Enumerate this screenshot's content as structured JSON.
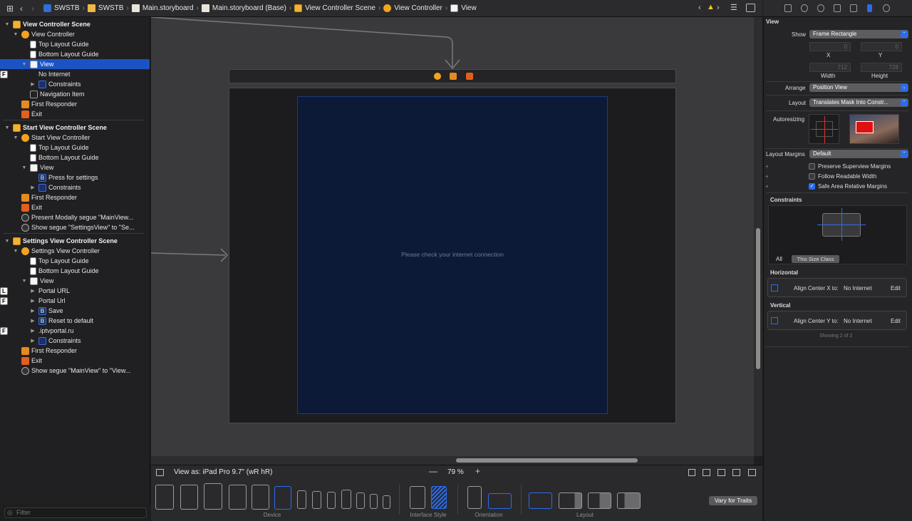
{
  "breadcrumb": [
    "SWSTB",
    "SWSTB",
    "Main.storyboard",
    "Main.storyboard (Base)",
    "View Controller Scene",
    "View Controller",
    "View"
  ],
  "outline": [
    {
      "label": "View Controller Scene",
      "kind": "scene",
      "indent": 0,
      "tri": "▼",
      "header": true
    },
    {
      "label": "View Controller",
      "kind": "vc",
      "indent": 1,
      "tri": "▼"
    },
    {
      "label": "Top Layout Guide",
      "kind": "guide",
      "indent": 2,
      "tri": ""
    },
    {
      "label": "Bottom Layout Guide",
      "kind": "guide",
      "indent": 2,
      "tri": ""
    },
    {
      "label": "View",
      "kind": "view",
      "indent": 2,
      "tri": "▼",
      "selected": true
    },
    {
      "label": "No Internet",
      "kind": "F",
      "indent": 3,
      "tri": ""
    },
    {
      "label": "Constraints",
      "kind": "cons",
      "indent": 3,
      "tri": "▶"
    },
    {
      "label": "Navigation Item",
      "kind": "nav",
      "indent": 2,
      "tri": ""
    },
    {
      "label": "First Responder",
      "kind": "resp",
      "indent": 1,
      "tri": ""
    },
    {
      "label": "Exit",
      "kind": "exit",
      "indent": 1,
      "tri": ""
    },
    {
      "label": "Start View Controller Scene",
      "kind": "scene",
      "indent": 0,
      "tri": "▼",
      "header": true
    },
    {
      "label": "Start View Controller",
      "kind": "vc",
      "indent": 1,
      "tri": "▼"
    },
    {
      "label": "Top Layout Guide",
      "kind": "guide",
      "indent": 2,
      "tri": ""
    },
    {
      "label": "Bottom Layout Guide",
      "kind": "guide",
      "indent": 2,
      "tri": ""
    },
    {
      "label": "View",
      "kind": "view",
      "indent": 2,
      "tri": "▼"
    },
    {
      "label": "Press for settings",
      "kind": "B",
      "indent": 3,
      "tri": ""
    },
    {
      "label": "Constraints",
      "kind": "cons",
      "indent": 3,
      "tri": "▶"
    },
    {
      "label": "First Responder",
      "kind": "resp",
      "indent": 1,
      "tri": ""
    },
    {
      "label": "Exit",
      "kind": "exit",
      "indent": 1,
      "tri": ""
    },
    {
      "label": "Present Modally segue \"MainView...",
      "kind": "segue",
      "indent": 1,
      "tri": ""
    },
    {
      "label": "Show segue \"SettingsView\" to \"Se...",
      "kind": "segue",
      "indent": 1,
      "tri": ""
    },
    {
      "label": "Settings View Controller Scene",
      "kind": "scene",
      "indent": 0,
      "tri": "▼",
      "header": true
    },
    {
      "label": "Settings View Controller",
      "kind": "vc",
      "indent": 1,
      "tri": "▼"
    },
    {
      "label": "Top Layout Guide",
      "kind": "guide",
      "indent": 2,
      "tri": ""
    },
    {
      "label": "Bottom Layout Guide",
      "kind": "guide",
      "indent": 2,
      "tri": ""
    },
    {
      "label": "View",
      "kind": "view",
      "indent": 2,
      "tri": "▼"
    },
    {
      "label": "Portal URL",
      "kind": "L",
      "indent": 3,
      "tri": "▶"
    },
    {
      "label": "Portal Url",
      "kind": "F",
      "indent": 3,
      "tri": "▶"
    },
    {
      "label": "Save",
      "kind": "B",
      "indent": 3,
      "tri": "▶"
    },
    {
      "label": "Reset to default",
      "kind": "B",
      "indent": 3,
      "tri": "▶"
    },
    {
      "label": ".iptvportal.ru",
      "kind": "F",
      "indent": 3,
      "tri": "▶"
    },
    {
      "label": "Constraints",
      "kind": "cons",
      "indent": 3,
      "tri": "▶"
    },
    {
      "label": "First Responder",
      "kind": "resp",
      "indent": 1,
      "tri": ""
    },
    {
      "label": "Exit",
      "kind": "exit",
      "indent": 1,
      "tri": ""
    },
    {
      "label": "Show segue \"MainView\" to \"View...",
      "kind": "segue",
      "indent": 1,
      "tri": ""
    }
  ],
  "filter_placeholder": "Filter",
  "canvas": {
    "message": "Please check your internet connection"
  },
  "bottom": {
    "view_as": "View as: iPad Pro 9.7\" (wR hR)",
    "zoom": "79 %",
    "device_label": "Device",
    "interface_style_label": "Interface Style",
    "orientation_label": "Orientation",
    "layout_label": "Layout",
    "vary_label": "Vary for Traits"
  },
  "inspector": {
    "section": "View",
    "show_label": "Show",
    "show_value": "Frame Rectangle",
    "x_label": "X",
    "y_label": "Y",
    "x": "0",
    "y": "0",
    "width_label": "Width",
    "height_label": "Height",
    "width": "712",
    "height": "728",
    "arrange_label": "Arrange",
    "arrange_value": "Position View",
    "layout_label": "Layout",
    "layout_value": "Translates Mask Into Constr...",
    "autoresizing_label": "Autoresizing",
    "margins_label": "Layout Margins",
    "margins_value": "Default",
    "preserve": "Preserve Superview Margins",
    "readable": "Follow Readable Width",
    "safearea": "Safe Area Relative Margins",
    "constraints_title": "Constraints",
    "all_tab": "All",
    "size_class_tab": "This Size Class",
    "horizontal": "Horizontal",
    "vertical": "Vertical",
    "h_constraint": "Align Center X to:",
    "h_target": "No Internet",
    "v_constraint": "Align Center Y to:",
    "v_target": "No Internet",
    "edit": "Edit",
    "showing": "Showing 2 of 2"
  }
}
